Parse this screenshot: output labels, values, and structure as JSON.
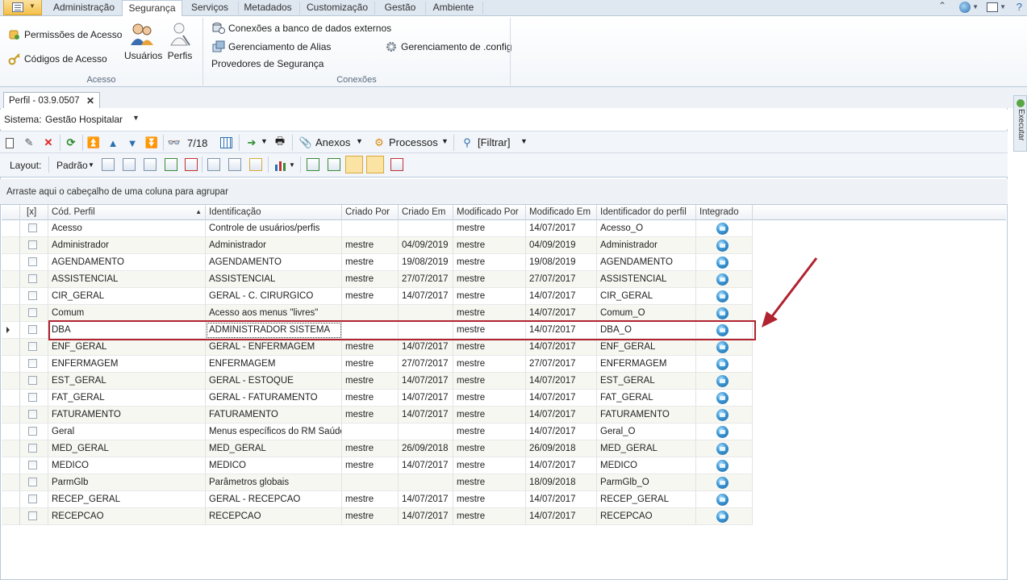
{
  "ribbon": {
    "tabs": [
      "Administração",
      "Segurança",
      "Serviços",
      "Metadados",
      "Customização",
      "Gestão",
      "Ambiente"
    ],
    "active_tab": "Segurança",
    "acesso": {
      "permissoes": "Permissões de Acesso",
      "codigos": "Códigos de Acesso",
      "usuarios": "Usuários",
      "perfis": "Perfis",
      "group_label": "Acesso"
    },
    "conexoes": {
      "banco_externo": "Conexões a banco de dados externos",
      "alias": "Gerenciamento de Alias",
      "provedores": "Provedores de Segurança",
      "config": "Gerenciamento de .config",
      "group_label": "Conexões"
    }
  },
  "document": {
    "tab_title": "Perfil - 03.9.0507",
    "side_panel": "Executar"
  },
  "sistema": {
    "label": "Sistema:",
    "value": "Gestão Hospitalar"
  },
  "toolbar": {
    "record_count": "7/18",
    "anexos": "Anexos",
    "processos": "Processos",
    "filtrar": "[Filtrar]",
    "layout_label": "Layout:",
    "padrao": "Padrão"
  },
  "groupby_hint": "Arraste aqui o cabeçalho de uma coluna para agrupar",
  "grid": {
    "columns": [
      "[x]",
      "Cód. Perfil",
      "Identificação",
      "Criado Por",
      "Criado Em",
      "Modificado Por",
      "Modificado Em",
      "Identificador do perfil",
      "Integrado"
    ],
    "rows": [
      [
        "Acesso",
        "Controle de usuários/perfis",
        "",
        "",
        "mestre",
        "14/07/2017",
        "Acesso_O"
      ],
      [
        "Administrador",
        "Administrador",
        "mestre",
        "04/09/2019",
        "mestre",
        "04/09/2019",
        "Administrador"
      ],
      [
        "AGENDAMENTO",
        "AGENDAMENTO",
        "mestre",
        "19/08/2019",
        "mestre",
        "19/08/2019",
        "AGENDAMENTO"
      ],
      [
        "ASSISTENCIAL",
        "ASSISTENCIAL",
        "mestre",
        "27/07/2017",
        "mestre",
        "27/07/2017",
        "ASSISTENCIAL"
      ],
      [
        "CIR_GERAL",
        "GERAL - C. CIRURGICO",
        "mestre",
        "14/07/2017",
        "mestre",
        "14/07/2017",
        "CIR_GERAL"
      ],
      [
        "Comum",
        "Acesso aos menus \"livres\"",
        "",
        "",
        "mestre",
        "14/07/2017",
        "Comum_O"
      ],
      [
        "DBA",
        "ADMINISTRADOR SISTEMA",
        "",
        "",
        "mestre",
        "14/07/2017",
        "DBA_O"
      ],
      [
        "ENF_GERAL",
        "GERAL - ENFERMAGEM",
        "mestre",
        "14/07/2017",
        "mestre",
        "14/07/2017",
        "ENF_GERAL"
      ],
      [
        "ENFERMAGEM",
        "ENFERMAGEM",
        "mestre",
        "27/07/2017",
        "mestre",
        "27/07/2017",
        "ENFERMAGEM"
      ],
      [
        "EST_GERAL",
        "GERAL - ESTOQUE",
        "mestre",
        "14/07/2017",
        "mestre",
        "14/07/2017",
        "EST_GERAL"
      ],
      [
        "FAT_GERAL",
        "GERAL - FATURAMENTO",
        "mestre",
        "14/07/2017",
        "mestre",
        "14/07/2017",
        "FAT_GERAL"
      ],
      [
        "FATURAMENTO",
        "FATURAMENTO",
        "mestre",
        "14/07/2017",
        "mestre",
        "14/07/2017",
        "FATURAMENTO"
      ],
      [
        "Geral",
        "Menus específicos do RM Saúde",
        "",
        "",
        "mestre",
        "14/07/2017",
        "Geral_O"
      ],
      [
        "MED_GERAL",
        "MED_GERAL",
        "mestre",
        "26/09/2018",
        "mestre",
        "26/09/2018",
        "MED_GERAL"
      ],
      [
        "MEDICO",
        "MEDICO",
        "mestre",
        "14/07/2017",
        "mestre",
        "14/07/2017",
        "MEDICO"
      ],
      [
        "ParmGlb",
        "Parâmetros globais",
        "",
        "",
        "mestre",
        "18/09/2018",
        "ParmGlb_O"
      ],
      [
        "RECEP_GERAL",
        "GERAL - RECEPCAO",
        "mestre",
        "14/07/2017",
        "mestre",
        "14/07/2017",
        "RECEP_GERAL"
      ],
      [
        "RECEPCAO",
        "RECEPCAO",
        "mestre",
        "14/07/2017",
        "mestre",
        "14/07/2017",
        "RECEPCAO"
      ]
    ],
    "selected_row": "DBA"
  },
  "colors": {
    "highlight_box": "#b0232f",
    "accent_tab": "#f4c04a"
  }
}
